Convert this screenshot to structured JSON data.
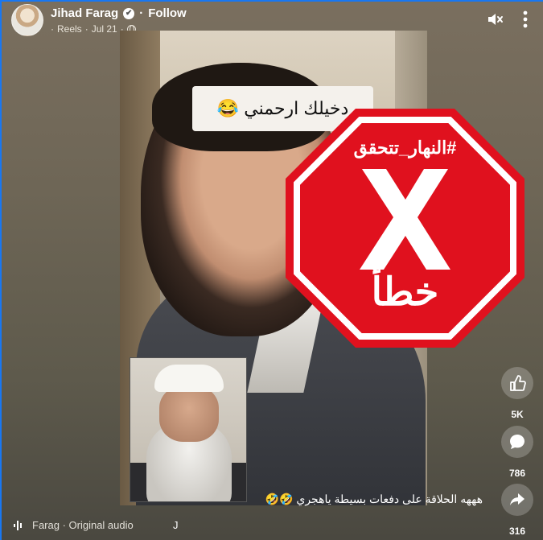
{
  "header": {
    "author": "Jihad Farag",
    "follow_label": "Follow",
    "separator": "·",
    "meta_prefix": "·",
    "source": "Reels",
    "date": "Jul 21",
    "verified_icon": "✔"
  },
  "video": {
    "overlay_caption": "دخيلك ارحمني 😂",
    "stamp": {
      "hashtag": "#النهار_تتحقق",
      "verdict": "خطأ",
      "color": "#e0111e"
    }
  },
  "actions": {
    "like_count": "5K",
    "comment_count": "786",
    "share_count": "316"
  },
  "post_caption": "هههه الحلاقة على دفعات بسيطة ياهجري 🤣🤣",
  "audio": {
    "text": "Farag · Original audio",
    "trailing": "J"
  },
  "colors": {
    "accent_border": "#1877f2",
    "stamp_red": "#e0111e"
  }
}
